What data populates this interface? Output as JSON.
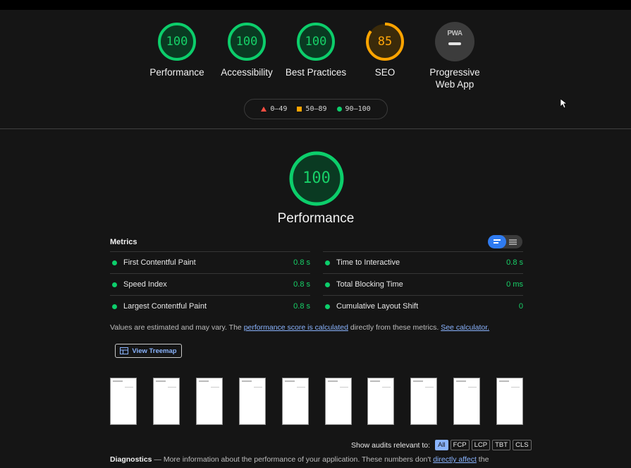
{
  "colors": {
    "pass": "#0cce6b",
    "average": "#ffa400",
    "fail": "#ff4e42",
    "link": "#8ab4ff",
    "background": "#151515"
  },
  "gauges": [
    {
      "score": "100",
      "label": "Performance",
      "level": 100
    },
    {
      "score": "100",
      "label": "Accessibility",
      "level": 100
    },
    {
      "score": "100",
      "label": "Best Practices",
      "level": 100
    },
    {
      "score": "85",
      "label": "SEO",
      "level": 85
    }
  ],
  "pwa": {
    "badge": "PWA",
    "label_line1": "Progressive",
    "label_line2": "Web App"
  },
  "legend": {
    "fail": "0–49",
    "average": "50–89",
    "pass": "90–100"
  },
  "performance": {
    "score": "100",
    "title": "Performance"
  },
  "metrics": {
    "heading": "Metrics",
    "left": [
      {
        "name": "First Contentful Paint",
        "value": "0.8 s"
      },
      {
        "name": "Speed Index",
        "value": "0.8 s"
      },
      {
        "name": "Largest Contentful Paint",
        "value": "0.8 s"
      }
    ],
    "right": [
      {
        "name": "Time to Interactive",
        "value": "0.8 s"
      },
      {
        "name": "Total Blocking Time",
        "value": "0 ms"
      },
      {
        "name": "Cumulative Layout Shift",
        "value": "0"
      }
    ]
  },
  "note": {
    "prefix": "Values are estimated and may vary. The ",
    "link1": "performance score is calculated",
    "middle": " directly from these metrics. ",
    "link2": "See calculator."
  },
  "treemap": {
    "label": "View Treemap"
  },
  "thumbnails_count": 10,
  "filter": {
    "label": "Show audits relevant to:",
    "chips": [
      "All",
      "FCP",
      "LCP",
      "TBT",
      "CLS"
    ],
    "active": "All"
  },
  "diagnostics": {
    "title": "Diagnostics",
    "text": " — More information about the performance of your application. These numbers don't ",
    "link": "directly affect",
    "suffix": " the"
  }
}
